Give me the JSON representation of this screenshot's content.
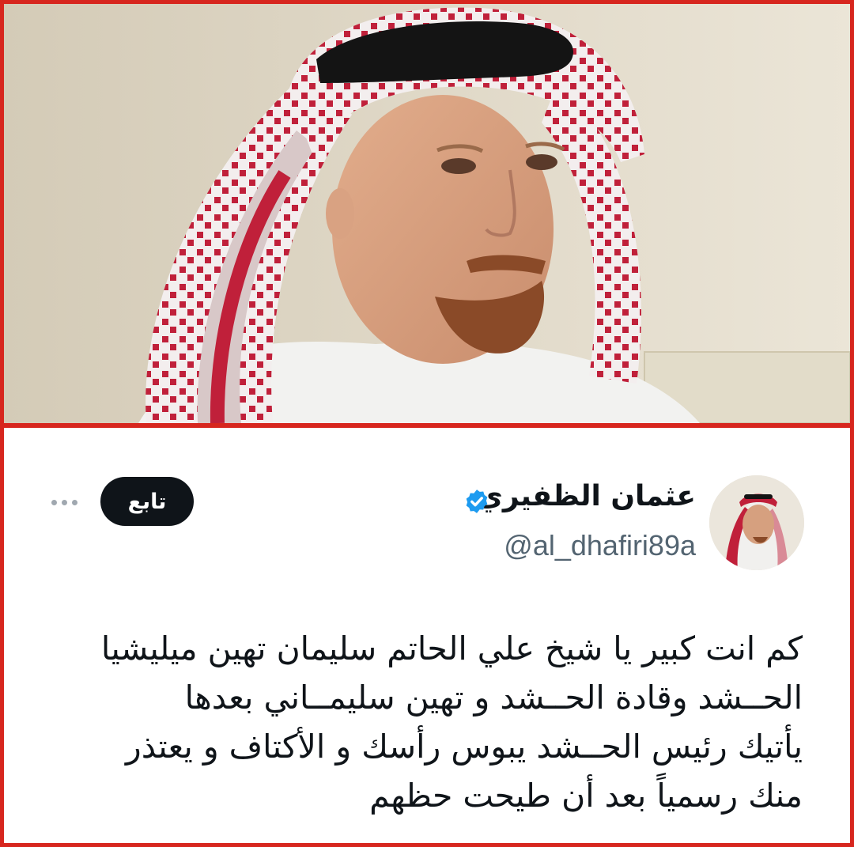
{
  "colors": {
    "frame": "#d7261e",
    "text": "#0f1419",
    "muted": "#536471",
    "button_bg": "#0f1419",
    "verified": "#1d9bf0"
  },
  "photo": {
    "subject": "man wearing red-and-white shemagh"
  },
  "tweet": {
    "display_name": "عثمان الظفيري",
    "handle": "@al_dhafiri89a",
    "verified_icon": "verified-badge-icon",
    "follow_label": "تابع",
    "more_icon": "more-options-icon",
    "text_lines": [
      "كم انت كبير يا شيخ علي الحاتم سليمان تهين ميليشيا",
      "الحــشد وقادة الحــشد و تهين سليمــاني بعدها",
      "يأتيك رئيس الحــشد يبوس رأسك و الأكتاف و يعتذر",
      "منك رسمياً بعد أن طيحت حظهم"
    ]
  }
}
